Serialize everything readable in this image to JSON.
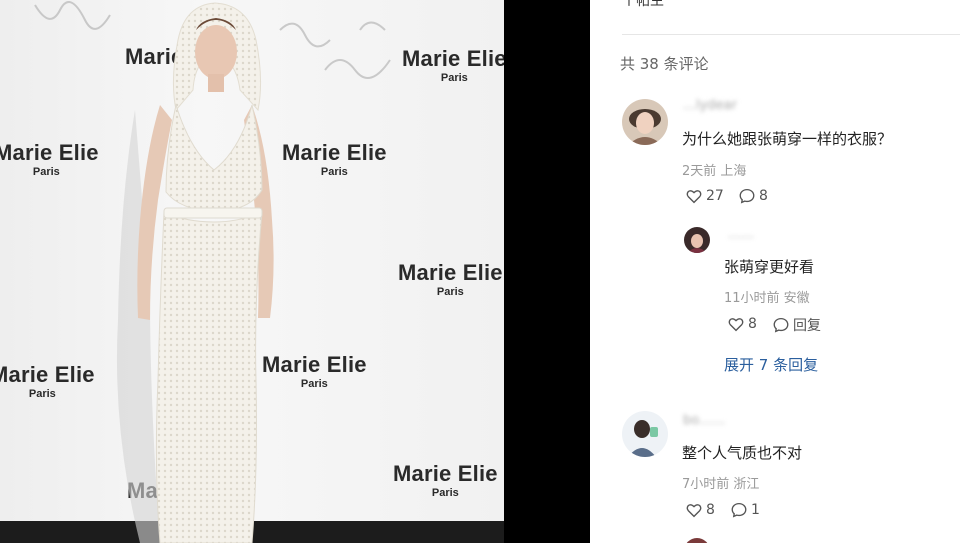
{
  "photo": {
    "brand": "Marie Elie",
    "city": "Paris"
  },
  "comments_panel": {
    "header_partial": "个帖主",
    "count_label": "共 38 条评论",
    "comments": [
      {
        "username": "…lydear",
        "text": "为什么她跟张萌穿一样的衣服？",
        "meta": "2天前 上海",
        "likes": "27",
        "replies": "8"
      },
      {
        "username": "……",
        "text": "张萌穿更好看",
        "meta": "11小时前 安徽",
        "likes": "8",
        "reply_label": "回复"
      },
      {
        "username": "bo……",
        "text": "整个人气质也不对",
        "meta": "7小时前 浙江",
        "likes": "8",
        "replies": "1"
      }
    ],
    "expand_label": "展开 7 条回复"
  },
  "colors": {
    "link": "#2b5f9e",
    "meta": "#9a9a9a"
  },
  "icons": [
    "heart-icon",
    "comment-icon"
  ]
}
